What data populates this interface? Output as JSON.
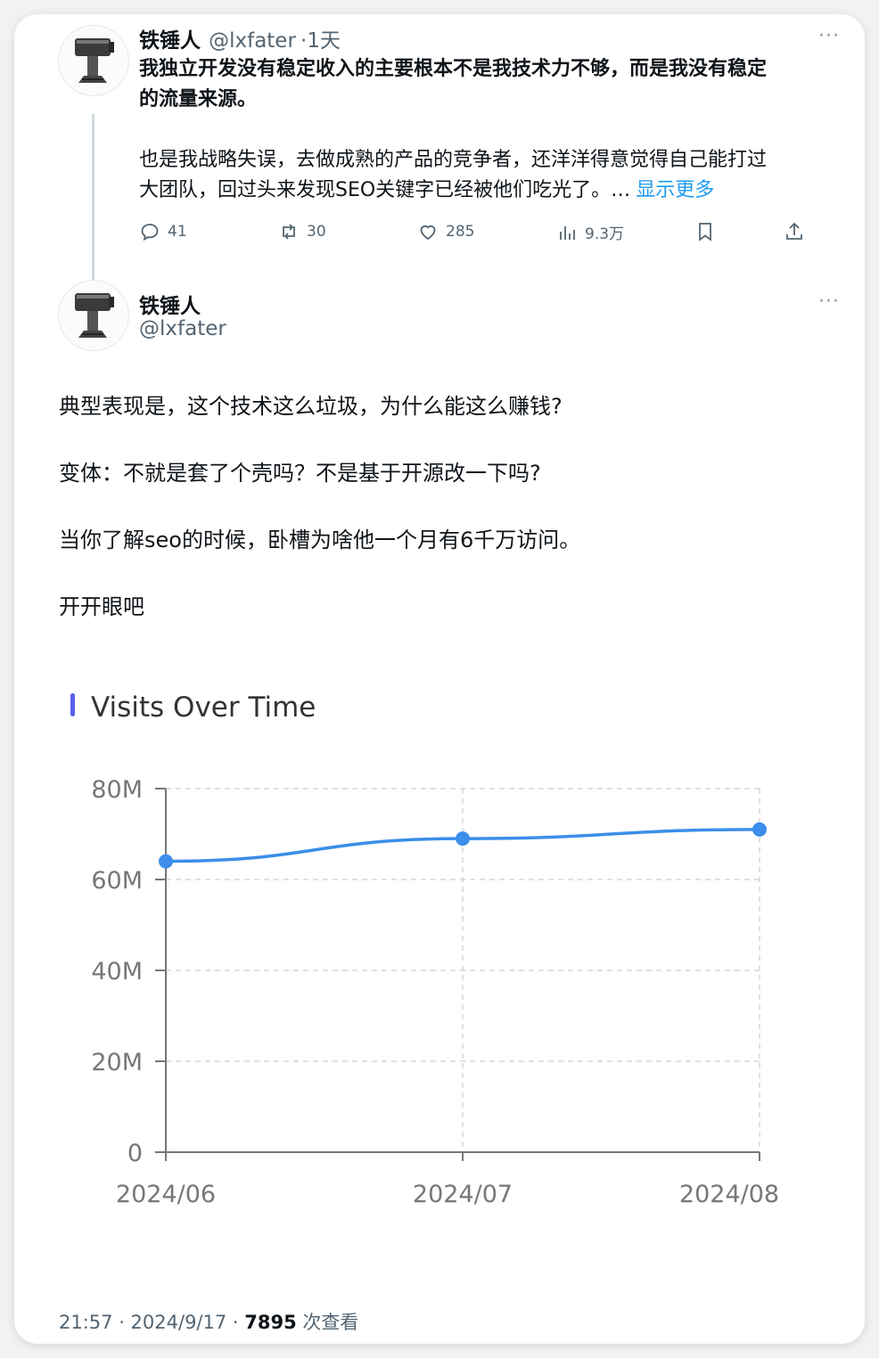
{
  "quoted": {
    "name": "铁锤人",
    "handle": "@lxfater",
    "time": "·1天",
    "line1": "我独立开发没有稳定收入的主要根本不是我技术力不够，而是我没有稳定",
    "line2": "的流量来源。",
    "line3": "也是我战略失误，去做成熟的产品的竞争者，还洋洋得意觉得自己能打过",
    "line4": "大团队，回过头来发现SEO关键字已经被他们吃光了。…",
    "show_more": "显示更多",
    "replies": "41",
    "reposts": "30",
    "likes": "285",
    "views": "9.3万",
    "more_icon": "···"
  },
  "main": {
    "name": "铁锤人",
    "handle": "@lxfater",
    "more_icon": "···",
    "paragraphs": [
      "典型表现是，这个技术这么垃圾，为什么能这么赚钱?",
      "变体：不就是套了个壳吗？不是基于开源改一下吗?",
      "当你了解seo的时候，卧槽为啥他一个月有6千万访问。",
      "开开眼吧"
    ]
  },
  "chart_data": {
    "type": "line",
    "title": "Visits Over Time",
    "categories": [
      "2024/06",
      "2024/07",
      "2024/08"
    ],
    "values": [
      64000000,
      69000000,
      71000000
    ],
    "ylim": [
      0,
      80000000
    ],
    "yticks": [
      "0",
      "20M",
      "40M",
      "60M",
      "80M"
    ],
    "grid": true,
    "colors": {
      "line": "#3b8eea",
      "accent": "#5b5fef",
      "grid": "#d6d6d6"
    }
  },
  "footer": {
    "time": "21:57 · 2024/9/17 · ",
    "views": "7895",
    "views_label": " 次查看"
  }
}
